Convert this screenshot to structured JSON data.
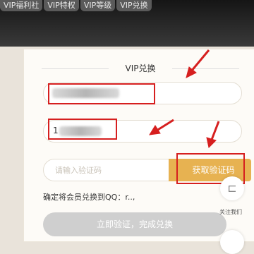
{
  "top_nav": {
    "tabs": [
      "VIP福利社",
      "VIP特权",
      "VIP等级",
      "VIP兑换"
    ]
  },
  "form": {
    "title": "VIP兑换",
    "account_value": "",
    "qq_value": "1",
    "code_placeholder": "请输入验证码",
    "get_code_label": "获取验证码",
    "confirm_text": "确定将会员兑换到QQ：",
    "confirm_qq_partial": "r..,",
    "submit_label": "立即验证，完成兑换"
  },
  "side": {
    "follow_label": "关注我们",
    "follow_icon": "qr-follow-icon"
  },
  "colors": {
    "accent": "#e7b251",
    "annotation_red": "#d61f1f",
    "disabled_button": "#cfcfcf"
  }
}
